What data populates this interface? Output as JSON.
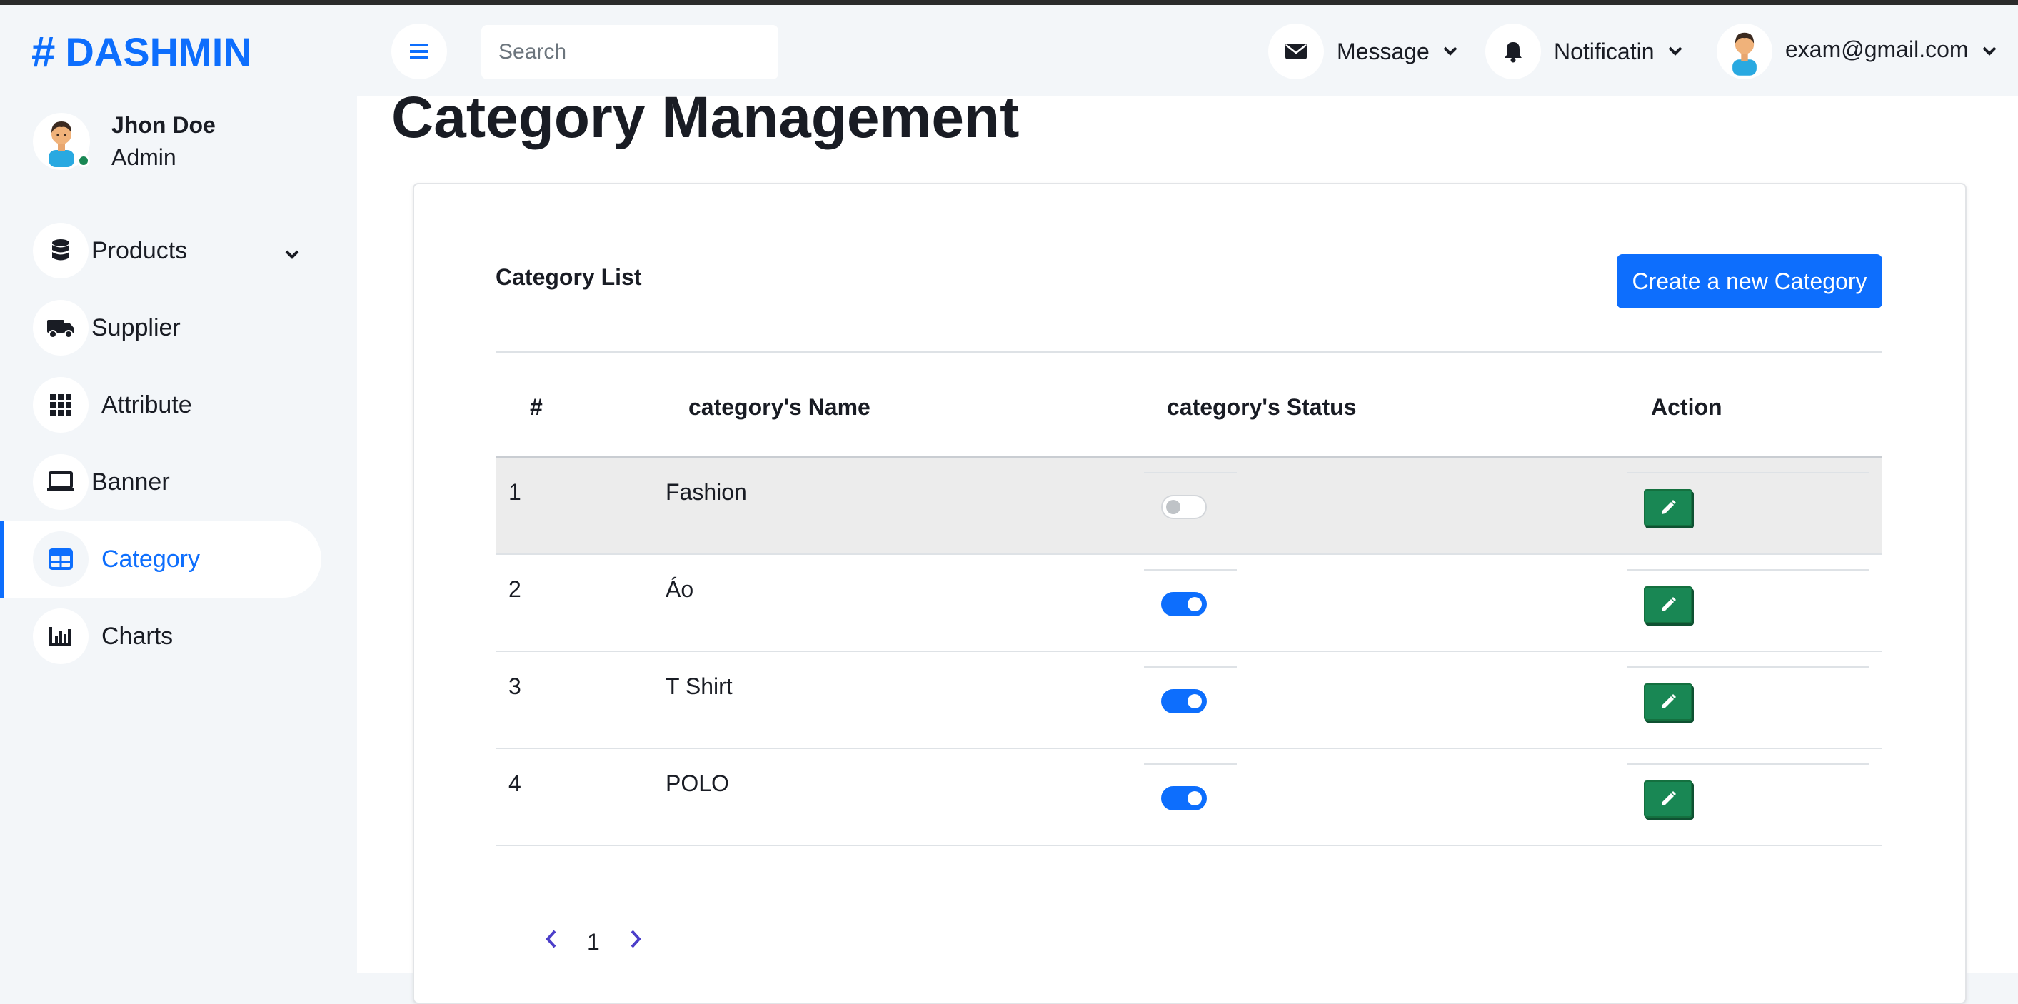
{
  "brand": {
    "name": "DASHMIN",
    "symbol": "#"
  },
  "profile": {
    "name": "Jhon Doe",
    "role": "Admin"
  },
  "sidebar": {
    "items": [
      {
        "label": "Products",
        "icon": "database-icon",
        "has_caret": true,
        "active": false
      },
      {
        "label": "Supplier",
        "icon": "truck-icon",
        "active": false
      },
      {
        "label": "Attribute",
        "icon": "grid-icon",
        "active": false
      },
      {
        "label": "Banner",
        "icon": "laptop-icon",
        "active": false
      },
      {
        "label": "Category",
        "icon": "table-icon",
        "active": true
      },
      {
        "label": "Charts",
        "icon": "bar-chart-icon",
        "active": false
      }
    ]
  },
  "topbar": {
    "search_placeholder": "Search",
    "message_label": "Message",
    "notification_label": "Notificatin",
    "user_email": "exam@gmail.com"
  },
  "page": {
    "title": "Category Management",
    "card_title": "Category List",
    "create_button": "Create a new Category"
  },
  "table": {
    "headers": [
      "#",
      "category's Name",
      "category's Status",
      "Action"
    ],
    "rows": [
      {
        "index": "1",
        "name": "Fashion",
        "status_on": false
      },
      {
        "index": "2",
        "name": "Áo",
        "status_on": true
      },
      {
        "index": "3",
        "name": "T Shirt",
        "status_on": true
      },
      {
        "index": "4",
        "name": "POLO",
        "status_on": true
      }
    ]
  },
  "pagination": {
    "current_page": "1"
  },
  "colors": {
    "primary": "#0d6efd",
    "success": "#198754",
    "sidebar_bg": "#f3f6f9",
    "text": "#191c24"
  }
}
